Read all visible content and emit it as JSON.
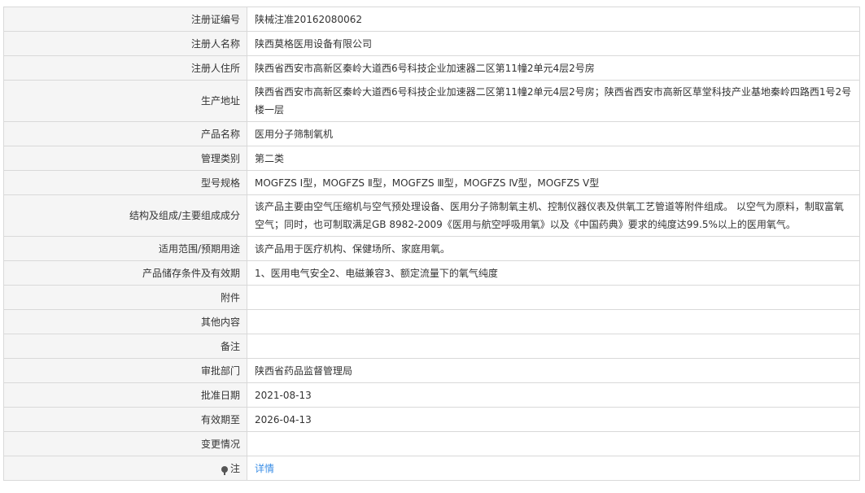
{
  "rows": [
    {
      "label": "注册证编号",
      "value": "陕械注准20162080062"
    },
    {
      "label": "注册人名称",
      "value": "陕西莫格医用设备有限公司"
    },
    {
      "label": "注册人住所",
      "value": "陕西省西安市高新区秦岭大道西6号科技企业加速器二区第11幢2单元4层2号房"
    },
    {
      "label": "生产地址",
      "value": "陕西省西安市高新区秦岭大道西6号科技企业加速器二区第11幢2单元4层2号房；陕西省西安市高新区草堂科技产业基地秦岭四路西1号2号楼一层"
    },
    {
      "label": "产品名称",
      "value": "医用分子筛制氧机"
    },
    {
      "label": "管理类别",
      "value": "第二类"
    },
    {
      "label": "型号规格",
      "value": "MOGFZS Ⅰ型，MOGFZS Ⅱ型，MOGFZS Ⅲ型，MOGFZS Ⅳ型，MOGFZS Ⅴ型"
    },
    {
      "label": "结构及组成/主要组成成分",
      "value": "该产品主要由空气压缩机与空气预处理设备、医用分子筛制氧主机、控制仪器仪表及供氧工艺管道等附件组成。 以空气为原料，制取富氧空气；同时，也可制取满足GB 8982-2009《医用与航空呼吸用氧》以及《中国药典》要求的纯度达99.5%以上的医用氧气。"
    },
    {
      "label": "适用范围/预期用途",
      "value": "该产品用于医疗机构、保健场所、家庭用氧。"
    },
    {
      "label": "产品储存条件及有效期",
      "value": "1、医用电气安全2、电磁兼容3、额定流量下的氧气纯度"
    },
    {
      "label": "附件",
      "value": ""
    },
    {
      "label": "其他内容",
      "value": ""
    },
    {
      "label": "备注",
      "value": ""
    },
    {
      "label": "审批部门",
      "value": "陕西省药品监督管理局"
    },
    {
      "label": "批准日期",
      "value": "2021-08-13"
    },
    {
      "label": "有效期至",
      "value": "2026-04-13"
    },
    {
      "label": "变更情况",
      "value": ""
    }
  ],
  "note_row": {
    "label": "注",
    "icon": "lightbulb-icon",
    "link_text": "详情",
    "link_color": "#3a8ee6"
  },
  "colors": {
    "label_bg": "#f5f5f5",
    "border": "#d9d9d9",
    "text": "#333333"
  }
}
